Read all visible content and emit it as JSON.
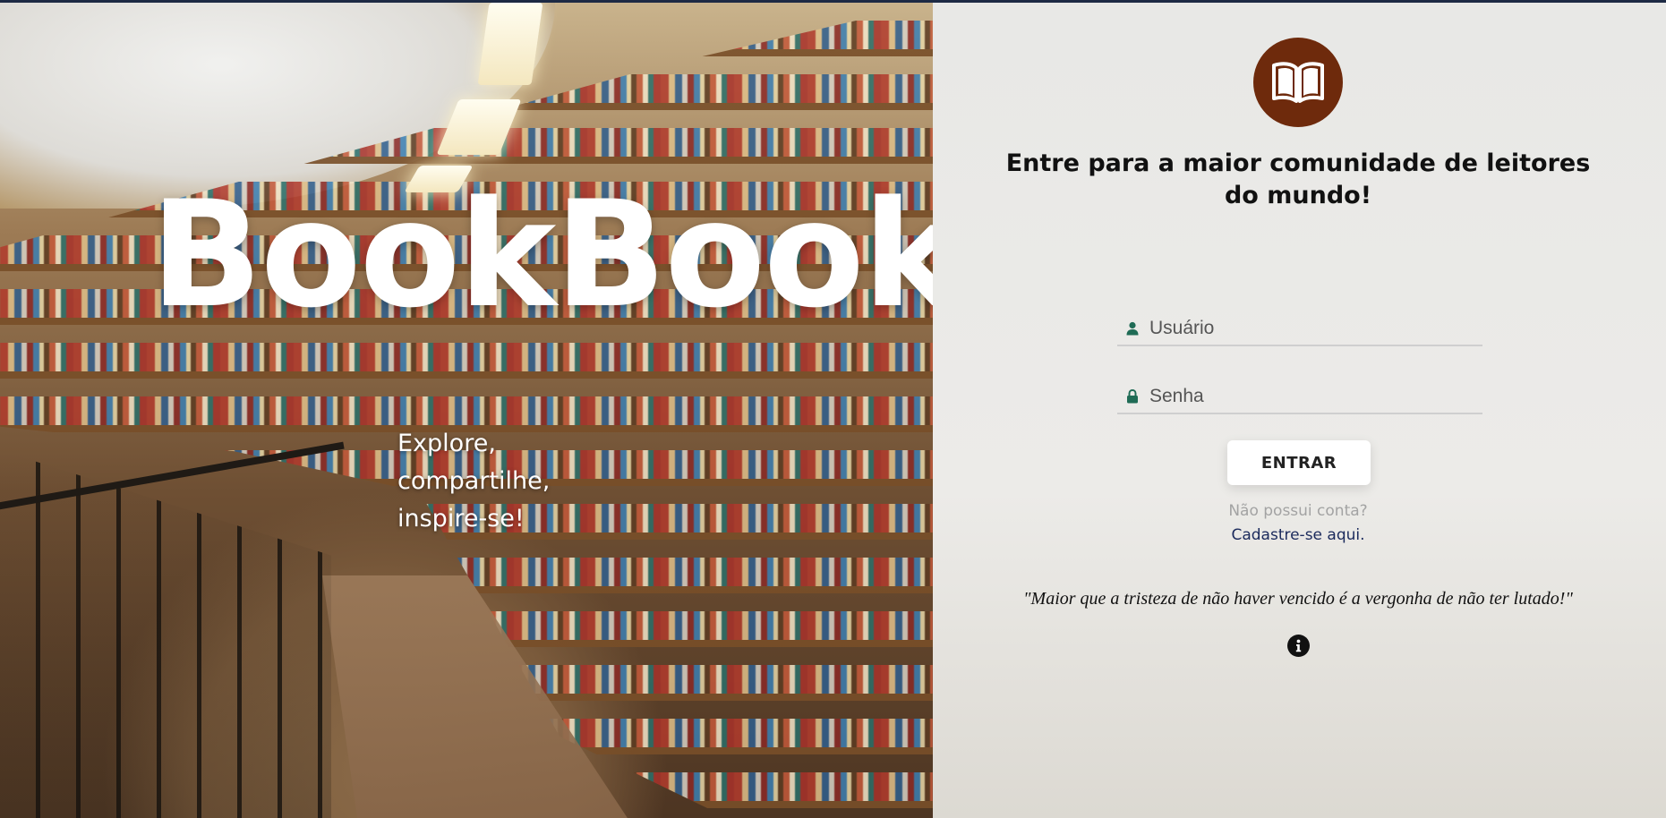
{
  "hero": {
    "brand": "BookBook",
    "tagline": [
      "Explore,",
      "compartilhe,",
      "inspire-se!"
    ]
  },
  "login": {
    "logo_icon": "open-book-icon",
    "headline": "Entre para a maior comunidade de leitores do mundo!",
    "username_placeholder": "Usuário",
    "username_icon": "user-icon",
    "password_placeholder": "Senha",
    "password_icon": "lock-icon",
    "submit_label": "ENTRAR",
    "no_account_text": "Não possui conta?",
    "signup_link": "Cadastre-se aqui.",
    "quote": "\"Maior que a tristeza de não haver vencido é a vergonha de não ter lutado!\"",
    "info_icon": "info-icon"
  },
  "colors": {
    "logo_bg": "#6e2a0c",
    "icon_green": "#1f6b55",
    "link": "#1b2a5c",
    "muted": "#a3a3a3"
  }
}
